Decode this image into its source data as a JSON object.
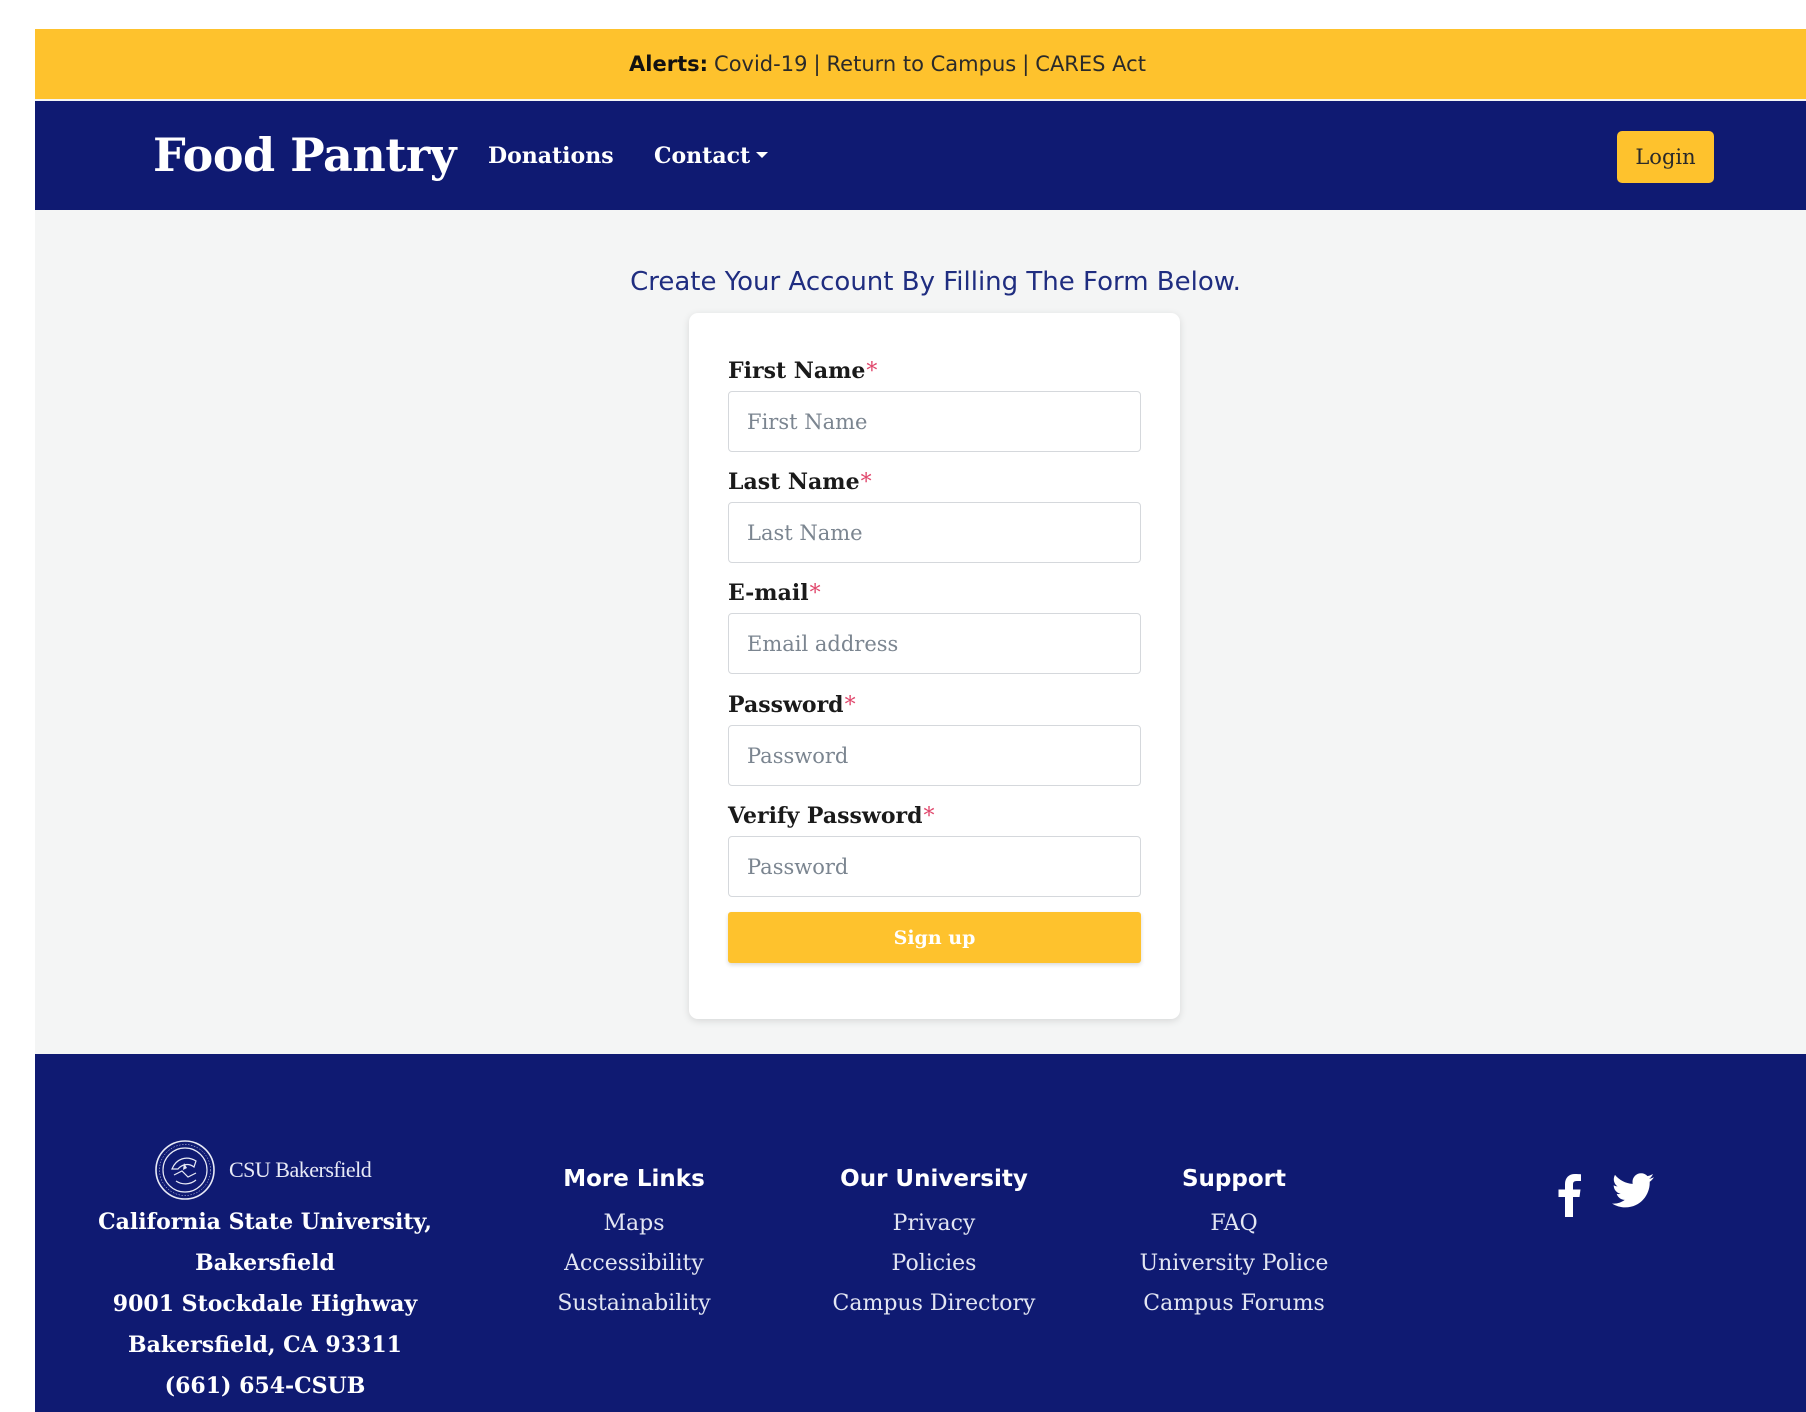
{
  "alert_bar": {
    "prefix": "Alerts:",
    "links": [
      "Covid-19",
      "Return to Campus",
      "CARES Act"
    ],
    "separator": "|"
  },
  "navbar": {
    "brand": "Food Pantry",
    "links": [
      "Donations",
      "Contact"
    ],
    "login_label": "Login"
  },
  "form": {
    "heading": "Create Your Account By Filling The Form Below.",
    "required_marker": "*",
    "fields": [
      {
        "label": "First Name",
        "placeholder": "First Name",
        "value": ""
      },
      {
        "label": "Last Name",
        "placeholder": "Last Name",
        "value": ""
      },
      {
        "label": "E-mail",
        "placeholder": "Email address",
        "value": ""
      },
      {
        "label": "Password",
        "placeholder": "Password",
        "value": ""
      },
      {
        "label": "Verify Password",
        "placeholder": "Password",
        "value": ""
      }
    ],
    "submit_label": "Sign up"
  },
  "footer": {
    "logo_text": "CSU Bakersfield",
    "address": [
      "California State University,",
      "Bakersfield",
      "9001 Stockdale Highway",
      "Bakersfield, CA 93311",
      "(661) 654-CSUB"
    ],
    "columns": [
      {
        "title": "More Links",
        "links": [
          "Maps",
          "Accessibility",
          "Sustainability"
        ]
      },
      {
        "title": "Our University",
        "links": [
          "Privacy",
          "Policies",
          "Campus Directory"
        ]
      },
      {
        "title": "Support",
        "links": [
          "FAQ",
          "University Police",
          "Campus Forums"
        ]
      }
    ],
    "social": [
      "facebook-icon",
      "twitter-icon"
    ]
  },
  "colors": {
    "alert_bg": "#fec22d",
    "navy": "#0f1a72",
    "accent": "#fec22d",
    "required": "#e0466b",
    "heading": "#1f2d80",
    "page_bg": "#f4f5f5"
  }
}
